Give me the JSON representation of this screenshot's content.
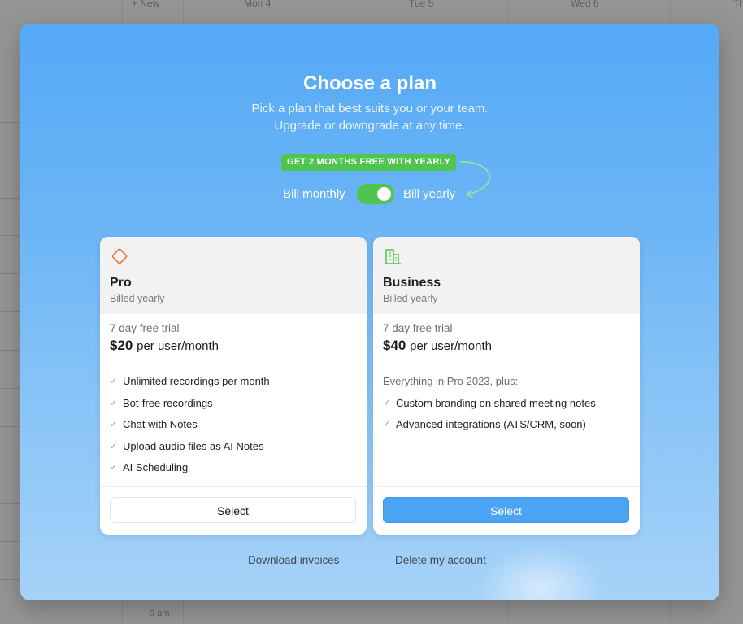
{
  "background": {
    "new_label": "+  New",
    "days": [
      "Mon  4",
      "Tue  5",
      "Wed  6",
      "Th"
    ],
    "time_label": "9 am"
  },
  "modal": {
    "title": "Choose a plan",
    "subtitle": "Pick a plan that best suits you or your team. Upgrade or downgrade at any time.",
    "promo_badge": "GET 2 MONTHS FREE WITH YEARLY",
    "billing": {
      "monthly_label": "Bill monthly",
      "yearly_label": "Bill yearly",
      "yearly_selected": true
    }
  },
  "plans": [
    {
      "name": "Pro",
      "billed": "Billed yearly",
      "trial": "7 day free trial",
      "price": "$20",
      "price_unit": "per user/month",
      "icon": "diamond-icon",
      "icon_color": "#e8733a",
      "intro": "",
      "features": [
        "Unlimited recordings per month",
        "Bot-free recordings",
        "Chat with Notes",
        "Upload audio files as AI Notes",
        "AI Scheduling"
      ],
      "button_label": "Select"
    },
    {
      "name": "Business",
      "billed": "Billed yearly",
      "trial": "7 day free trial",
      "price": "$40",
      "price_unit": "per user/month",
      "icon": "building-icon",
      "icon_color": "#4fc54f",
      "intro": "Everything in Pro 2023, plus:",
      "features": [
        "Custom branding on shared meeting notes",
        "Advanced integrations (ATS/CRM, soon)"
      ],
      "button_label": "Select"
    }
  ],
  "footer": {
    "download_invoices": "Download invoices",
    "delete_account": "Delete my account"
  },
  "colors": {
    "accent_blue": "#4aa3f3",
    "promo_green": "#4fc54f",
    "pro_icon": "#e8733a"
  }
}
